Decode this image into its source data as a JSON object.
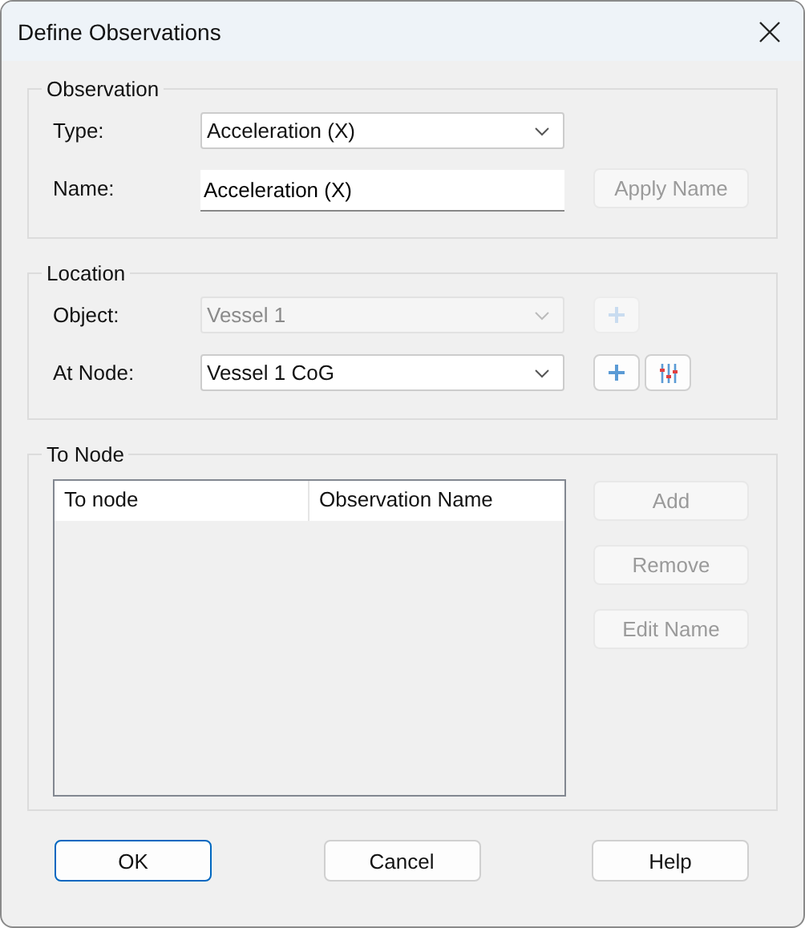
{
  "window": {
    "title": "Define Observations"
  },
  "observation": {
    "title": "Observation",
    "type": {
      "label": "Type:",
      "value": "Acceleration (X)",
      "disabled": false
    },
    "name": {
      "label": "Name:",
      "value": "Acceleration (X)"
    },
    "apply_button": {
      "label": "Apply Name",
      "disabled": true
    }
  },
  "location": {
    "title": "Location",
    "object": {
      "label": "Object:",
      "value": "Vessel 1",
      "disabled": true,
      "add_disabled": true
    },
    "at_node": {
      "label": "At Node:",
      "value": "Vessel 1 CoG",
      "disabled": false,
      "add_disabled": false
    }
  },
  "to_node": {
    "title": "To Node",
    "columns": [
      "To node",
      "Observation Name"
    ],
    "buttons": [
      {
        "label": "Add",
        "disabled": true
      },
      {
        "label": "Remove",
        "disabled": true
      },
      {
        "label": "Edit Name",
        "disabled": true
      }
    ]
  },
  "buttons": [
    {
      "label": "OK",
      "default": true
    },
    {
      "label": "Cancel",
      "default": false
    },
    {
      "label": "Help",
      "default": false
    }
  ]
}
